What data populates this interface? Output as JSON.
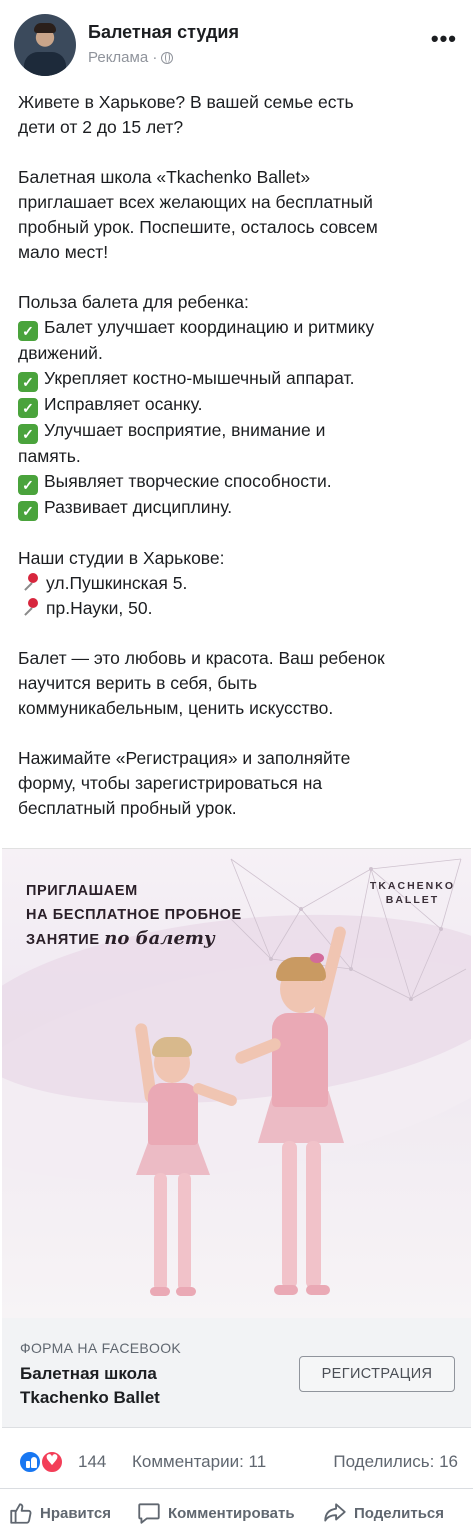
{
  "header": {
    "page_name": "Балетная студия",
    "sponsored": "Реклама ·",
    "more": "•••"
  },
  "post": {
    "lines": [
      "Живете в Харькове? В вашей семье есть",
      "дети от 2 до 15 лет?",
      "",
      "Балетная школа «Tkachenko Ballet»",
      "приглашает всех желающих на бесплатный",
      "пробный урок. Поспешите, осталось совсем",
      "мало мест!",
      "",
      "Польза балета для ребенка:"
    ],
    "benefits": [
      [
        "Балет улучшает координацию и ритмику",
        "движений."
      ],
      [
        "Укрепляет костно-мышечный аппарат."
      ],
      [
        "Исправляет осанку."
      ],
      [
        "Улучшает восприятие, внимание и",
        "память."
      ],
      [
        "Выявляет творческие способности."
      ],
      [
        "Развивает дисциплину."
      ]
    ],
    "check_mark": "✓",
    "studios_title": "Наши студии в Харькове:",
    "studios": [
      "ул.Пушкинская 5.",
      "пр.Науки, 50."
    ],
    "closing": [
      "Балет — это любовь и красота. Ваш ребенок",
      "научится верить в себя, быть",
      "коммуникабельным, ценить искусство."
    ],
    "cta_text": [
      "Нажимайте «Регистрация» и заполняйте",
      "форму, чтобы зарегистрироваться на",
      "бесплатный пробный урок."
    ]
  },
  "image": {
    "headline_lines": [
      "ПРИГЛАШАЕМ",
      "НА БЕСПЛАТНОЕ ПРОБНОЕ",
      "ЗАНЯТИЕ"
    ],
    "headline_script": "по балету",
    "logo_line1": "TKACHENKO",
    "logo_line2": "BALLET"
  },
  "ad_footer": {
    "kicker": "ФОРМА НА FACEBOOK",
    "headline_line1": "Балетная школа",
    "headline_line2": "Tkachenko Ballet",
    "cta_label": "РЕГИСТРАЦИЯ"
  },
  "stats": {
    "reactions": "144",
    "comments": "Комментарии: 11",
    "shares": "Поделились: 16"
  },
  "actions": {
    "like": "Нравится",
    "comment": "Комментировать",
    "share": "Поделиться"
  },
  "colors": {
    "like_blue": "#1877f2",
    "love_red": "#f33e58",
    "check_green": "#4aa33c",
    "ad_footer_bg": "#f2f3f5"
  }
}
